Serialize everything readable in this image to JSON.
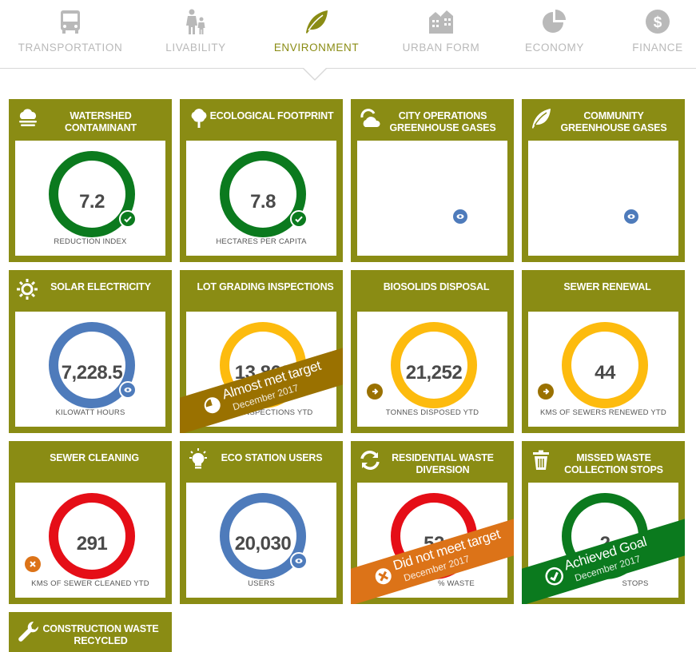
{
  "nav": {
    "items": [
      {
        "label": "TRANSPORTATION",
        "icon": "bus-icon"
      },
      {
        "label": "LIVABILITY",
        "icon": "family-icon"
      },
      {
        "label": "ENVIRONMENT",
        "icon": "leaf-icon"
      },
      {
        "label": "URBAN FORM",
        "icon": "buildings-icon"
      },
      {
        "label": "ECONOMY",
        "icon": "pie-chart-icon"
      },
      {
        "label": "FINANCE",
        "icon": "dollar-icon"
      }
    ],
    "active": "ENVIRONMENT"
  },
  "colors": {
    "tile": "#8a8c14",
    "green": "#0b7a1e",
    "blue": "#4e7bbb",
    "yellow": "#fdbb0e",
    "red": "#e50e17",
    "ribbon_almost": "#9a7100",
    "ribbon_missed": "#dc7318",
    "ribbon_achieved": "#0b7a1e"
  },
  "tiles": [
    {
      "title": "WATERSHED CONTAMINANT",
      "icon": "cloud-rain-icon",
      "value": "7.2",
      "unit": "REDUCTION INDEX",
      "ring": "green",
      "badge": "check-icon"
    },
    {
      "title": "ECOLOGICAL FOOTPRINT",
      "icon": "tree-icon",
      "value": "7.8",
      "unit": "HECTARES PER CAPITA",
      "ring": "green",
      "badge": "check-icon"
    },
    {
      "title": "CITY OPERATIONS GREENHOUSE GASES",
      "icon": "sun-cloud-icon",
      "badge": "eye-icon"
    },
    {
      "title": "COMMUNITY GREENHOUSE GASES",
      "icon": "leaf-icon",
      "badge": "eye-icon"
    },
    {
      "title": "SOLAR ELECTRICITY",
      "icon": "sun-icon",
      "value": "7,228.5",
      "unit": "KILOWATT HOURS",
      "ring": "blue",
      "badge": "eye-icon"
    },
    {
      "title": "LOT GRADING INSPECTIONS",
      "icon": "",
      "value": "13,862",
      "unit": "INSPECTIONS YTD",
      "ring": "yellow",
      "ribbon": {
        "main": "Almost met target",
        "sub": "December 2017",
        "icon": "pie-chart-icon"
      }
    },
    {
      "title": "BIOSOLIDS DISPOSAL",
      "icon": "",
      "value": "21,252",
      "unit": "TONNES DISPOSED YTD",
      "ring": "yellow",
      "badge": "arrow-right-icon"
    },
    {
      "title": "SEWER RENEWAL",
      "icon": "",
      "value": "44",
      "unit": "KMS OF SEWERS RENEWED YTD",
      "ring": "yellow",
      "badge": "arrow-right-icon"
    },
    {
      "title": "SEWER CLEANING",
      "icon": "",
      "value": "291",
      "unit": "KMS OF SEWER CLEANED YTD",
      "ring": "red",
      "badge": "x-icon"
    },
    {
      "title": "ECO STATION USERS",
      "icon": "lightbulb-icon",
      "value": "20,030",
      "unit": "USERS",
      "ring": "blue",
      "badge": "eye-icon"
    },
    {
      "title": "RESIDENTIAL WASTE DIVERSION",
      "icon": "recycle-icon",
      "value": "52",
      "unit": "% WASTE",
      "ring": "red",
      "ribbon": {
        "main": "Did not meet target",
        "sub": "December 2017",
        "icon": "x-icon"
      }
    },
    {
      "title": "MISSED WASTE COLLECTION STOPS",
      "icon": "trash-icon",
      "value": "2",
      "unit": "STOPS",
      "ring": "green",
      "ribbon": {
        "main": "Achieved Goal",
        "sub": "December 2017",
        "icon": "check-icon"
      }
    },
    {
      "title": "CONSTRUCTION WASTE RECYCLED",
      "icon": "wrench-icon"
    }
  ]
}
